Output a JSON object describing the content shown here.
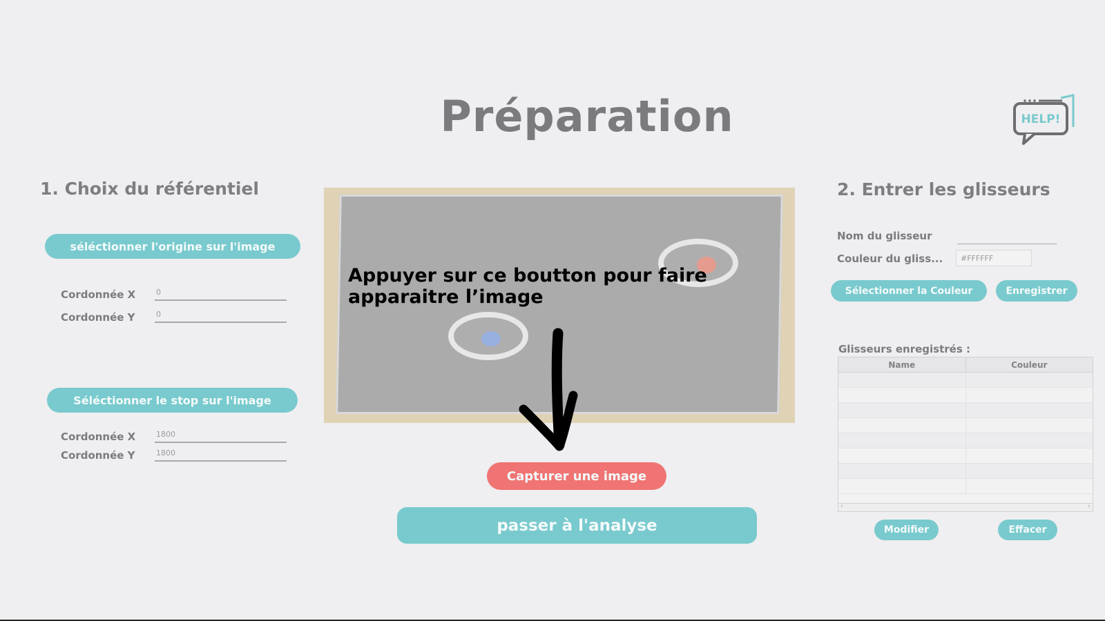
{
  "title": "Préparation",
  "help_label": "HELP!",
  "left": {
    "section_title": "1. Choix du référentiel",
    "origin_button": "séléctionner l'origine sur l'image",
    "origin_x_label": "Cordonnée X",
    "origin_x_value": "0",
    "origin_y_label": "Cordonnée Y",
    "origin_y_value": "0",
    "stop_button": "Séléctionner le stop sur l'image",
    "stop_x_label": "Cordonnée X",
    "stop_x_value": "1800",
    "stop_y_label": "Cordonnée Y",
    "stop_y_value": "1800"
  },
  "center": {
    "overlay_line1": "Appuyer sur ce boutton pour faire",
    "overlay_line2": "apparaitre l’image",
    "capture_button": "Capturer une image",
    "analyse_button": "passer à l'analyse"
  },
  "right": {
    "section_title": "2. Entrer les glisseurs",
    "name_label": "Nom du glisseur",
    "name_value": "",
    "color_label": "Couleur du gliss...",
    "color_value": "#FFFFFF",
    "select_color_button": "Sélectionner la Couleur",
    "save_button": "Enregistrer",
    "saved_label": "Glisseurs enregistrés :",
    "table_columns": [
      "Name",
      "Couleur"
    ],
    "modify_button": "Modifier",
    "delete_button": "Effacer"
  },
  "colors": {
    "background": "#efeef0",
    "teal": "#79cace",
    "red": "#ef7473",
    "puck_blue": "#6f93d8",
    "puck_red": "#e0735f"
  }
}
